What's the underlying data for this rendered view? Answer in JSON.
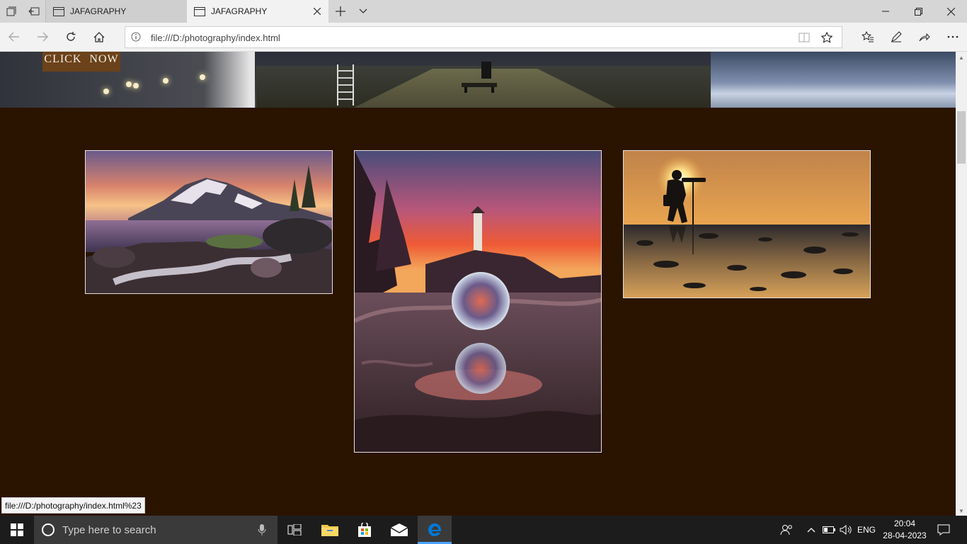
{
  "browser": {
    "tabs": [
      {
        "title": "JAFAGRAPHY",
        "active": false
      },
      {
        "title": "JAFAGRAPHY",
        "active": true
      }
    ],
    "address": "file:///D:/photography/index.html"
  },
  "page": {
    "cta_label": "CLICK  NOW",
    "gallery": [
      {
        "icon": "mountain-lake-photo",
        "alt": "mountain lake at sunset"
      },
      {
        "icon": "lighthouse-crystal-ball-photo",
        "alt": "crystal ball with lighthouse reflection"
      },
      {
        "icon": "photographer-silhouette-photo",
        "alt": "photographer silhouette at sunset"
      }
    ]
  },
  "status_url": "file:///D:/photography/index.html%23",
  "taskbar": {
    "search_placeholder": "Type here to search",
    "language": "ENG",
    "time": "20:04",
    "date": "28-04-2023"
  },
  "colors": {
    "page_bg": "#2a1400",
    "cta_bg": "#6b4219",
    "taskbar_bg": "#1c1c1c",
    "edge_blue": "#0078d7"
  }
}
